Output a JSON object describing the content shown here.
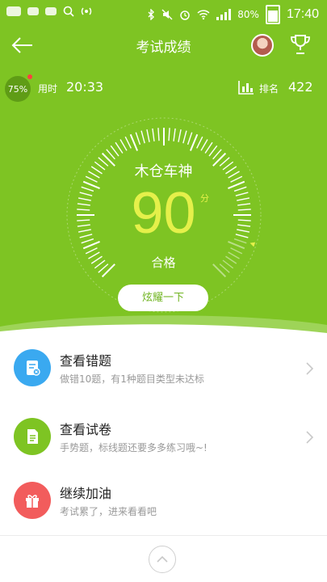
{
  "status_bar": {
    "battery": "80%",
    "time": "17:40"
  },
  "header": {
    "title": "考试成绩"
  },
  "stats": {
    "progress": "75%",
    "time_label": "用时",
    "time_value": "20:33",
    "rank_label": "排名",
    "rank_value": "422"
  },
  "result": {
    "rank_title": "木仓车神",
    "score": "90",
    "unit": "分",
    "status": "合格",
    "share_label": "炫耀一下",
    "gauge_fraction": 0.9
  },
  "list": [
    {
      "title": "查看错题",
      "subtitle": "做错10题，有1种题目类型未达标",
      "icon": "wrong-questions-icon",
      "color": "#3aa9f0"
    },
    {
      "title": "查看试卷",
      "subtitle": "手势题，标线题还要多多练习哦~!",
      "icon": "exam-paper-icon",
      "color": "#7ec423"
    },
    {
      "title": "继续加油",
      "subtitle": "考试累了，进来看看吧",
      "icon": "gift-icon",
      "color": "#f25c5c"
    }
  ],
  "colors": {
    "accent": "#7ec423",
    "score": "#e5f04a"
  }
}
